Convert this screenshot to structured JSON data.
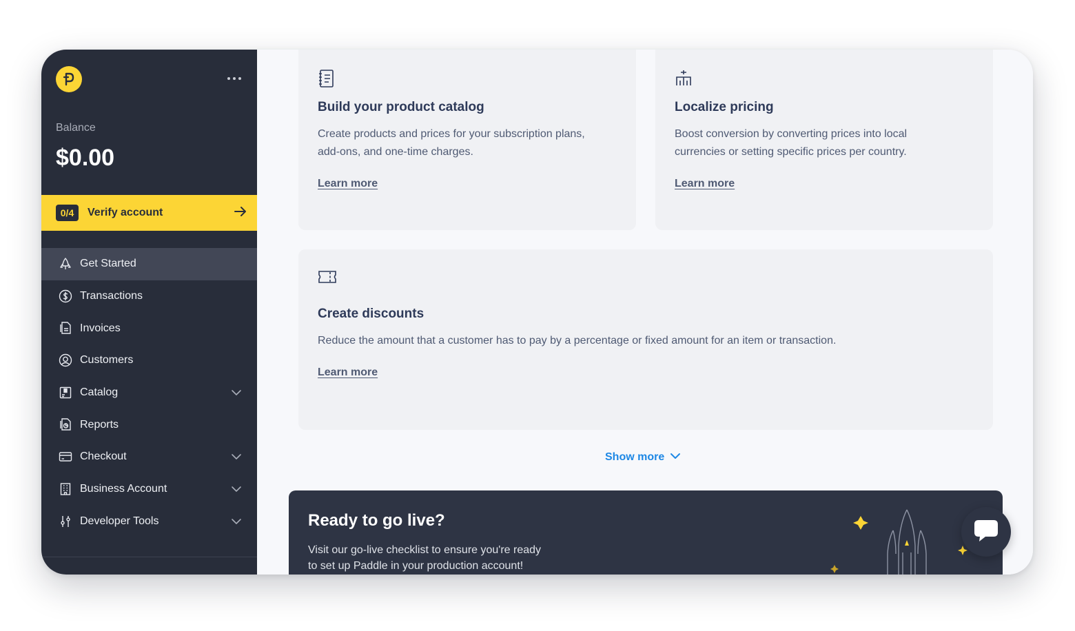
{
  "colors": {
    "sidebar_bg": "#282d3a",
    "accent_yellow": "#fcd535",
    "link_blue": "#1e88e5",
    "title_navy": "#2e3a59",
    "card_bg": "#f0f1f4"
  },
  "sidebar": {
    "logo_icon": "paddle-logo-icon",
    "more_icon": "ellipsis-icon",
    "balance_label": "Balance",
    "balance_value": "$0.00",
    "verify": {
      "badge": "0/4",
      "label": "Verify account",
      "icon": "arrow-right-icon"
    },
    "items": [
      {
        "label": "Get Started",
        "icon": "rocket-icon",
        "active": true,
        "expandable": false
      },
      {
        "label": "Transactions",
        "icon": "dollar-circle-icon",
        "active": false,
        "expandable": false
      },
      {
        "label": "Invoices",
        "icon": "invoice-icon",
        "active": false,
        "expandable": false
      },
      {
        "label": "Customers",
        "icon": "user-circle-icon",
        "active": false,
        "expandable": false
      },
      {
        "label": "Catalog",
        "icon": "catalog-icon",
        "active": false,
        "expandable": true
      },
      {
        "label": "Reports",
        "icon": "reports-icon",
        "active": false,
        "expandable": false
      },
      {
        "label": "Checkout",
        "icon": "credit-card-icon",
        "active": false,
        "expandable": true
      },
      {
        "label": "Business Account",
        "icon": "building-icon",
        "active": false,
        "expandable": true
      },
      {
        "label": "Developer Tools",
        "icon": "sliders-icon",
        "active": false,
        "expandable": true
      }
    ]
  },
  "main": {
    "cards": {
      "catalog": {
        "icon": "notebook-icon",
        "title": "Build your product catalog",
        "desc_line1": "Create products and prices for your subscription plans,",
        "desc_line2": "add-ons, and one-time charges.",
        "link": "Learn more"
      },
      "pricing": {
        "icon": "hierarchy-icon",
        "title": "Localize pricing",
        "desc_line1": "Boost conversion by converting prices into local",
        "desc_line2": "currencies or setting specific prices per country.",
        "link": "Learn more"
      },
      "discounts": {
        "icon": "coupon-icon",
        "title": "Create discounts",
        "desc": "Reduce the amount that a customer has to pay by a percentage or fixed amount for an item or transaction.",
        "link": "Learn more"
      }
    },
    "show_more": "Show more",
    "golive": {
      "title": "Ready to go live?",
      "desc_line1": "Visit our go-live checklist to ensure you're ready",
      "desc_line2": "to set up Paddle in your production account!",
      "illustration": "rocket-launch-icon"
    },
    "chat_icon": "chat-bubble-icon"
  }
}
